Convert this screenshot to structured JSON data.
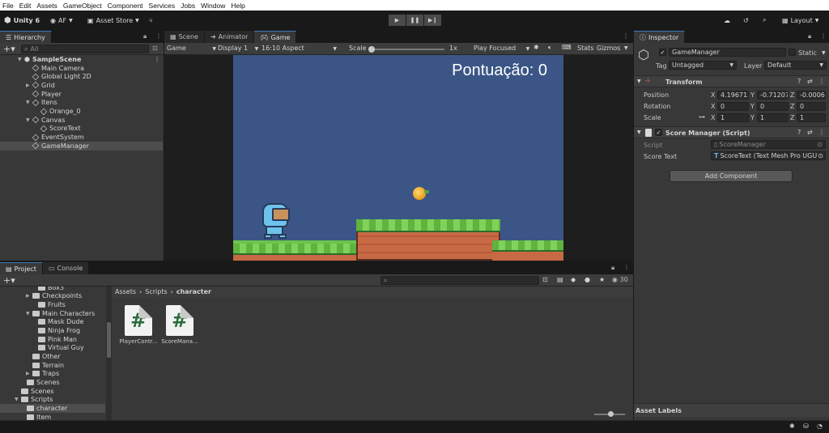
{
  "menu": [
    "File",
    "Edit",
    "Assets",
    "GameObject",
    "Component",
    "Services",
    "Jobs",
    "Window",
    "Help"
  ],
  "toolbar": {
    "app_label": "Unity 6",
    "account_label": "AF",
    "asset_store_label": "Asset Store",
    "layout_label": "Layout"
  },
  "hierarchy": {
    "tab_label": "Hierarchy",
    "search_placeholder": "All",
    "scene_name": "SampleScene",
    "items": [
      {
        "label": "Main Camera",
        "indent": 2
      },
      {
        "label": "Global Light 2D",
        "indent": 2
      },
      {
        "label": "Grid",
        "indent": 2,
        "expand": "▶"
      },
      {
        "label": "Player",
        "indent": 2
      },
      {
        "label": "Itens",
        "indent": 2,
        "expand": "▼"
      },
      {
        "label": "Orange_0",
        "indent": 3
      },
      {
        "label": "Canvas",
        "indent": 2,
        "expand": "▼"
      },
      {
        "label": "ScoreText",
        "indent": 3
      },
      {
        "label": "EventSystem",
        "indent": 2
      },
      {
        "label": "GameManager",
        "indent": 2,
        "selected": true
      }
    ]
  },
  "view_tabs": {
    "scene": "Scene",
    "animator": "Animator",
    "game": "Game"
  },
  "game_bar": {
    "mode": "Game",
    "display": "Display 1",
    "aspect": "16:10 Aspect",
    "scale_label": "Scale",
    "scale_value": "1x",
    "play_focused": "Play Focused",
    "stats": "Stats",
    "gizmos": "Gizmos"
  },
  "game_view": {
    "score_text": "Pontuação: 0",
    "sky_color": "#3b5686"
  },
  "inspector": {
    "tab_label": "Inspector",
    "object_name": "GameManager",
    "static_label": "Static",
    "tag_label": "Tag",
    "tag_value": "Untagged",
    "layer_label": "Layer",
    "layer_value": "Default",
    "transform": {
      "title": "Transform",
      "position_label": "Position",
      "rotation_label": "Rotation",
      "scale_label": "Scale",
      "position": {
        "x": "4.196712",
        "y": "-0.71207",
        "z": "-0.0006"
      },
      "rotation": {
        "x": "0",
        "y": "0",
        "z": "0"
      },
      "scale": {
        "x": "1",
        "y": "1",
        "z": "1"
      }
    },
    "script_component": {
      "title": "Score Manager (Script)",
      "script_label": "Script",
      "script_value": "ScoreManager",
      "score_text_label": "Score Text",
      "score_text_value": "ScoreText (Text Mesh Pro UGU"
    },
    "add_component": "Add Component",
    "asset_labels": "Asset Labels"
  },
  "project": {
    "tab_label": "Project",
    "console_tab_label": "Console",
    "breadcrumb": [
      "Assets",
      "Scripts",
      "character"
    ],
    "hidden_count": "30",
    "tree": [
      {
        "label": "Box3",
        "indent": 5,
        "folder": true
      },
      {
        "label": "Checkpoints",
        "indent": 4,
        "expand": "▶",
        "folder": true
      },
      {
        "label": "Fruits",
        "indent": 5,
        "folder": true
      },
      {
        "label": "Main Characters",
        "indent": 4,
        "expand": "▼",
        "folder": true
      },
      {
        "label": "Mask Dude",
        "indent": 5,
        "folder": true
      },
      {
        "label": "Ninja Frog",
        "indent": 5,
        "folder": true
      },
      {
        "label": "Pink Man",
        "indent": 5,
        "folder": true
      },
      {
        "label": "Virtual Guy",
        "indent": 5,
        "folder": true
      },
      {
        "label": "Other",
        "indent": 4,
        "folder": true
      },
      {
        "label": "Terrain",
        "indent": 4,
        "folder": true
      },
      {
        "label": "Traps",
        "indent": 4,
        "expand": "▶",
        "folder": true
      },
      {
        "label": "Scenes",
        "indent": 3,
        "folder": true
      },
      {
        "label": "Scenes",
        "indent": 2,
        "folder": true
      },
      {
        "label": "Scripts",
        "indent": 2,
        "expand": "▼",
        "folder": true
      },
      {
        "label": "character",
        "indent": 3,
        "folder": true,
        "selected": true
      },
      {
        "label": "Item",
        "indent": 3,
        "folder": true
      }
    ],
    "files": [
      {
        "label": "PlayerContr...",
        "icon": "#"
      },
      {
        "label": "ScoreMana...",
        "icon": "#"
      }
    ]
  }
}
